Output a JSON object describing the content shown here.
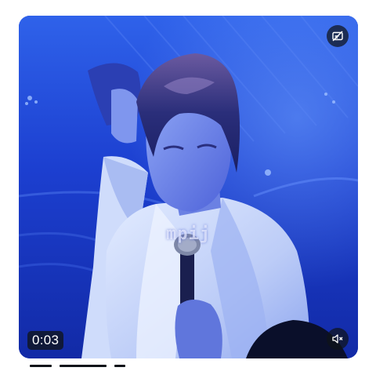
{
  "media": {
    "watermark_text": "mpij",
    "timestamp": "0:03",
    "colors": {
      "scene_blue": "#1b3cc7",
      "control_bg": "#0f1419",
      "control_icon": "#ffffff",
      "page_bg": "#ffffff"
    },
    "icons": {
      "top_right": "hide-caption-icon",
      "bottom_right": "speaker-muted-icon"
    }
  }
}
